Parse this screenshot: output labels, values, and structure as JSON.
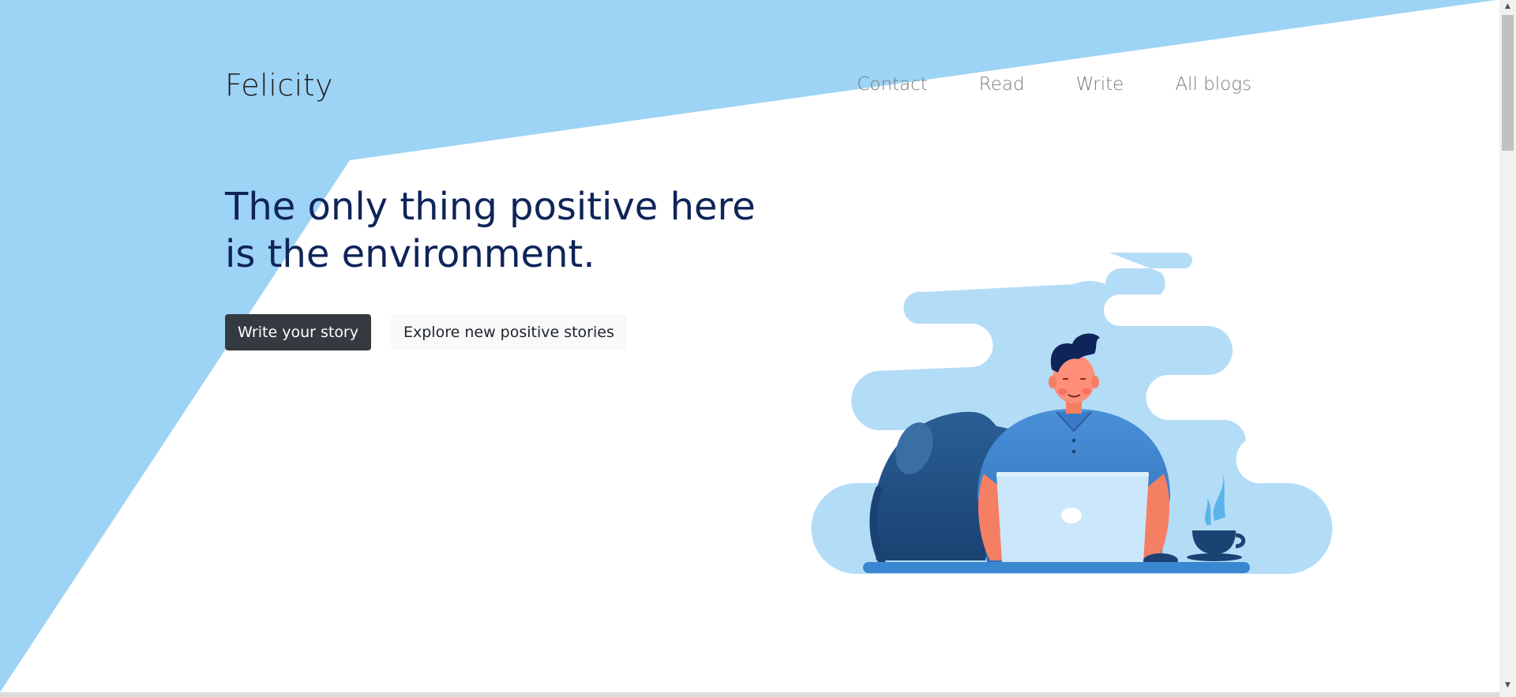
{
  "header": {
    "brand": "Felicity",
    "nav": [
      {
        "label": "Contact"
      },
      {
        "label": "Read"
      },
      {
        "label": "Write"
      },
      {
        "label": "All blogs"
      }
    ]
  },
  "hero": {
    "title_line1": "The only thing positive here",
    "title_line2": "is the environment.",
    "primary_button": "Write your story",
    "secondary_button": "Explore new positive stories"
  },
  "colors": {
    "background_shape": "#9dd3f5",
    "title": "#0f2459",
    "primary_button": "#343a40",
    "secondary_button": "#f8f9fa",
    "nav_link": "#7a7a7a"
  },
  "illustration": {
    "subject": "person-working-on-laptop-with-dog-and-coffee",
    "icons": [
      "cloud-icon",
      "person-icon",
      "dog-icon",
      "laptop-icon",
      "coffee-cup-icon"
    ]
  },
  "scrollbar": {
    "up_icon": "arrow-up-icon",
    "down_icon": "arrow-down-icon"
  }
}
